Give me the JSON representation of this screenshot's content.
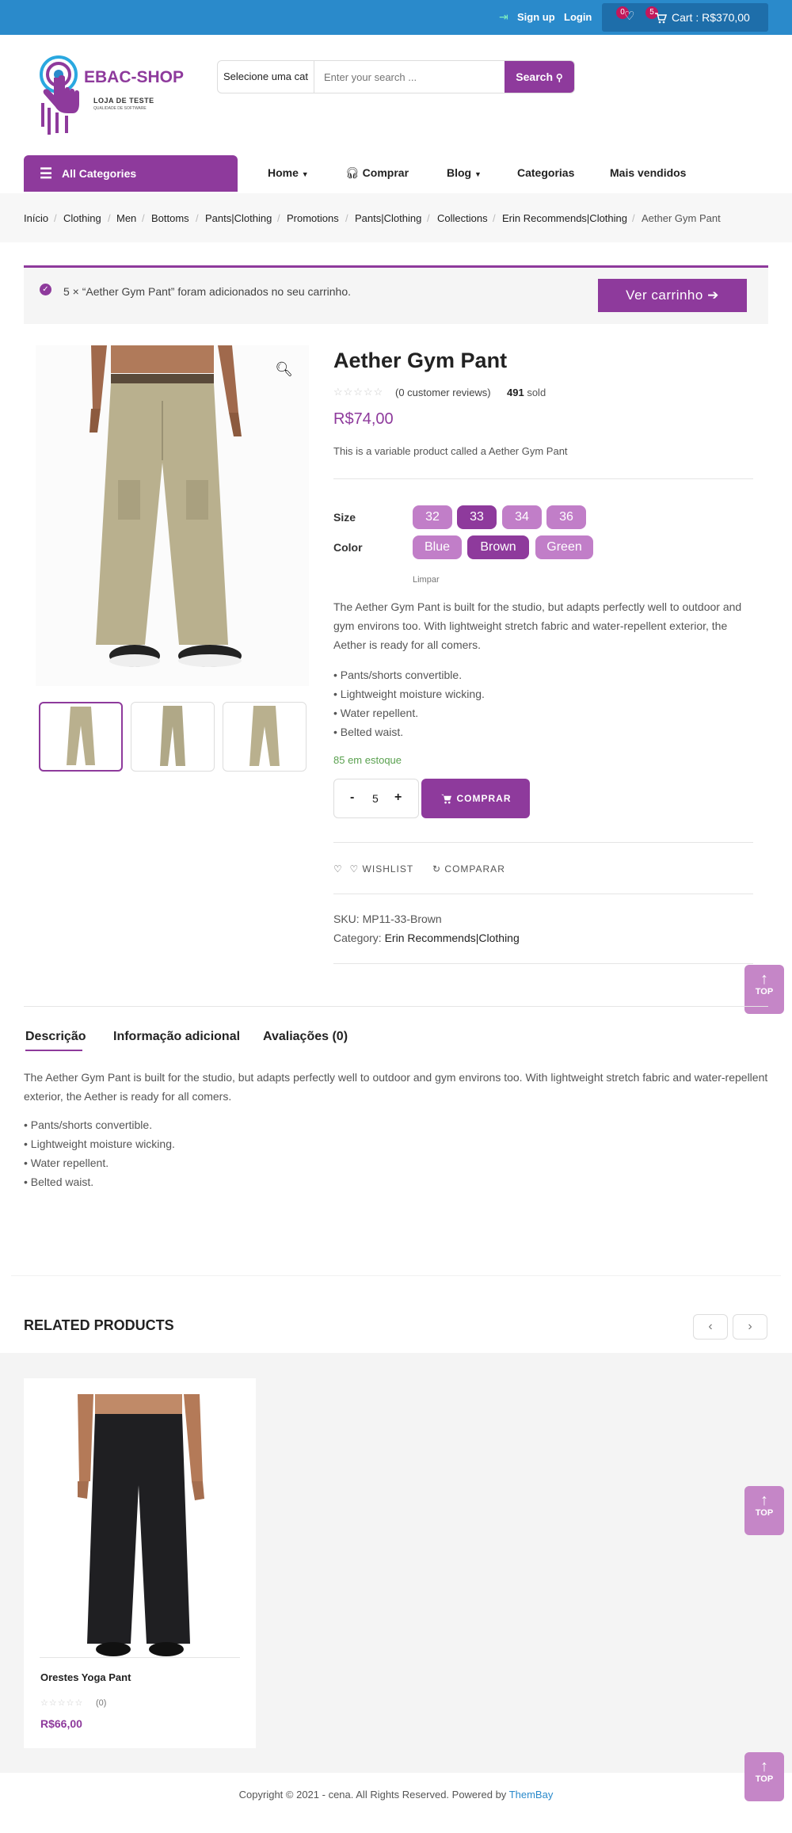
{
  "topbar": {
    "signup": "Sign up",
    "login": "Login",
    "wishlist_count": "0",
    "cart_count": "5",
    "cart_label": "Cart : R$370,00"
  },
  "logo": {
    "name": "EBAC-SHOP",
    "tagline": "LOJA DE TESTE",
    "tagline2": "QUALIDADE DE SOFTWARE"
  },
  "search": {
    "category": "Selecione uma cat",
    "placeholder": "Enter your search ...",
    "button": "Search"
  },
  "nav": {
    "all_categories": "All Categories",
    "items": [
      "Home",
      "Comprar",
      "Blog",
      "Categorias",
      "Mais vendidos"
    ]
  },
  "breadcrumb": [
    "Início",
    "Clothing",
    "Men",
    "Bottoms",
    "Pants|Clothing",
    "Promotions",
    "Pants|Clothing",
    "Collections",
    "Erin Recommends|Clothing",
    "Aether Gym Pant"
  ],
  "notice": {
    "text": "5 × “Aether Gym Pant” foram adicionados no seu carrinho.",
    "button": "Ver carrinho"
  },
  "product": {
    "title": "Aether Gym Pant",
    "reviews": "(0 customer reviews)",
    "sold_count": "491",
    "sold_label": "sold",
    "price": "R$74,00",
    "short_desc": "This is a variable product called a Aether Gym Pant",
    "size_label": "Size",
    "sizes": [
      "32",
      "33",
      "34",
      "36"
    ],
    "selected_size": "33",
    "color_label": "Color",
    "colors": [
      "Blue",
      "Brown",
      "Green"
    ],
    "selected_color": "Brown",
    "clear": "Limpar",
    "description": "The Aether Gym Pant is built for the studio, but adapts perfectly well to outdoor and gym environs too. With lightweight stretch fabric and water-repellent exterior, the Aether is ready for all comers.",
    "bullets": [
      "• Pants/shorts convertible.",
      "• Lightweight moisture wicking.",
      "• Water repellent.",
      "• Belted waist."
    ],
    "stock": "85 em estoque",
    "quantity": "5",
    "qty_minus": "-",
    "qty_plus": "+",
    "buy_button": "COMPRAR",
    "wishlist": "WISHLIST",
    "compare": "COMPARAR",
    "sku": "SKU: MP11-33-Brown",
    "category_label": "Category:",
    "category_value": "Erin Recommends|Clothing"
  },
  "tabs": [
    "Descrição",
    "Informação adicional",
    "Avaliações (0)"
  ],
  "tab_content": {
    "description": "The Aether Gym Pant is built for the studio, but adapts perfectly well to outdoor and gym environs too. With lightweight stretch fabric and water-repellent exterior, the Aether is ready for all comers.",
    "bullets": [
      "• Pants/shorts convertible.",
      "• Lightweight moisture wicking.",
      "• Water repellent.",
      "• Belted waist."
    ]
  },
  "top_button": "TOP",
  "related": {
    "title": "RELATED PRODUCTS",
    "products": [
      {
        "name": "Orestes Yoga Pant",
        "reviews": "(0)",
        "price": "R$66,00"
      }
    ]
  },
  "footer": {
    "copyright": "Copyright © 2021 - cena. All Rights Reserved. Powered by",
    "link": "ThemBay"
  },
  "colors": {
    "brand": "#8e3a9c",
    "topbar": "#2a8acb",
    "swatch": "#c17ec8",
    "stock": "#5aa14f"
  },
  "icons": [
    "signup-icon",
    "heart-icon",
    "cart-icon",
    "search-icon",
    "menu-icon",
    "headset-icon",
    "zoom-icon",
    "check-circle-icon",
    "arrow-right-icon",
    "arrow-up-icon",
    "refresh-icon",
    "chevron-left-icon",
    "chevron-right-icon"
  ]
}
